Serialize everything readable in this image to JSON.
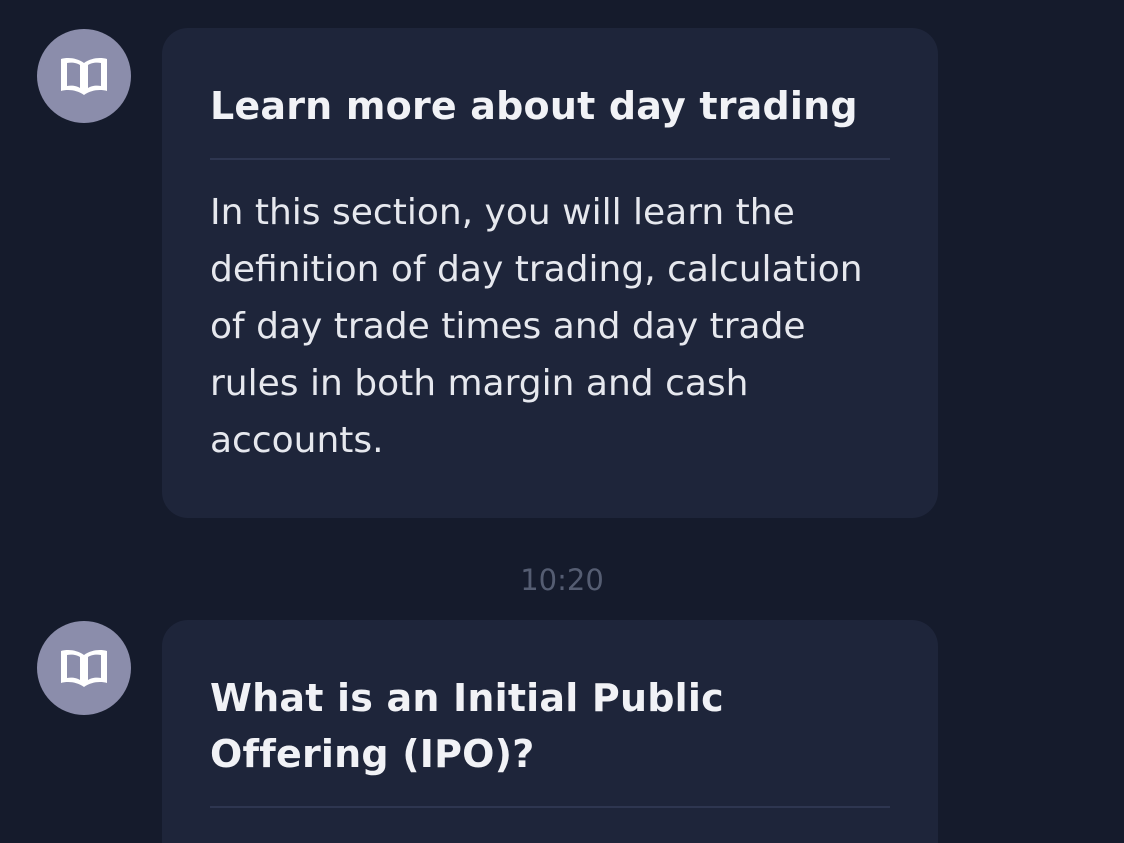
{
  "messages": [
    {
      "icon": "open-book-icon",
      "title": "Learn more about day trading",
      "body": "In this section, you will learn the definition of day trading, calculation of day trade times and day trade rules in both margin and cash accounts."
    },
    {
      "icon": "open-book-icon",
      "title": "What is an Initial Public Offering (IPO)?"
    }
  ],
  "timestamp": "10:20",
  "colors": {
    "background": "#151b2c",
    "card": "#1e253a",
    "avatar": "#8b8dab",
    "timestamp_text": "#555d72"
  }
}
